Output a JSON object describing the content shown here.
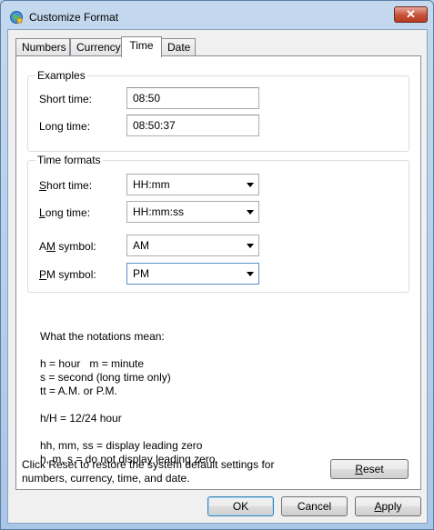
{
  "window": {
    "title": "Customize Format",
    "close_glyph": "✕"
  },
  "tabs": [
    {
      "label": "Numbers"
    },
    {
      "label": "Currency"
    },
    {
      "label": "Time",
      "active": true
    },
    {
      "label": "Date"
    }
  ],
  "examples": {
    "legend": "Examples",
    "short_label": "Short time:",
    "short_value": "08:50",
    "long_label": "Long time:",
    "long_value": "08:50:37"
  },
  "formats": {
    "legend": "Time formats",
    "short_label_key": "S",
    "short_label_rest": "hort time:",
    "short_value": "HH:mm",
    "long_label_key": "L",
    "long_label_rest": "ong time:",
    "long_value": "HH:mm:ss",
    "am_label_pre": "A",
    "am_label_key": "M",
    "am_label_rest": " symbol:",
    "am_value": "AM",
    "pm_label_key": "P",
    "pm_label_rest": "M symbol:",
    "pm_value": "PM"
  },
  "notations": {
    "heading": "What the notations mean:",
    "line1": "h = hour   m = minute",
    "line2": "s = second (long time only)",
    "line3": "tt = A.M. or P.M.",
    "line4": "h/H = 12/24 hour",
    "line5": "hh, mm, ss = display leading zero",
    "line6": "h, m, s = do not display leading zero"
  },
  "reset": {
    "text_line1": "Click Reset to restore the system default settings for",
    "text_line2": "numbers, currency, time, and date.",
    "button_key": "R",
    "button_rest": "eset"
  },
  "footer": {
    "ok": "OK",
    "cancel": "Cancel",
    "apply_key": "A",
    "apply_rest": "pply"
  },
  "colors": {
    "title_bar": "#b9d1ea",
    "close_button": "#c6513a",
    "default_button_border": "#3c7fb1"
  },
  "icons": {
    "app": "region-globe-icon",
    "close": "close-icon",
    "dropdown": "chevron-down-icon"
  }
}
